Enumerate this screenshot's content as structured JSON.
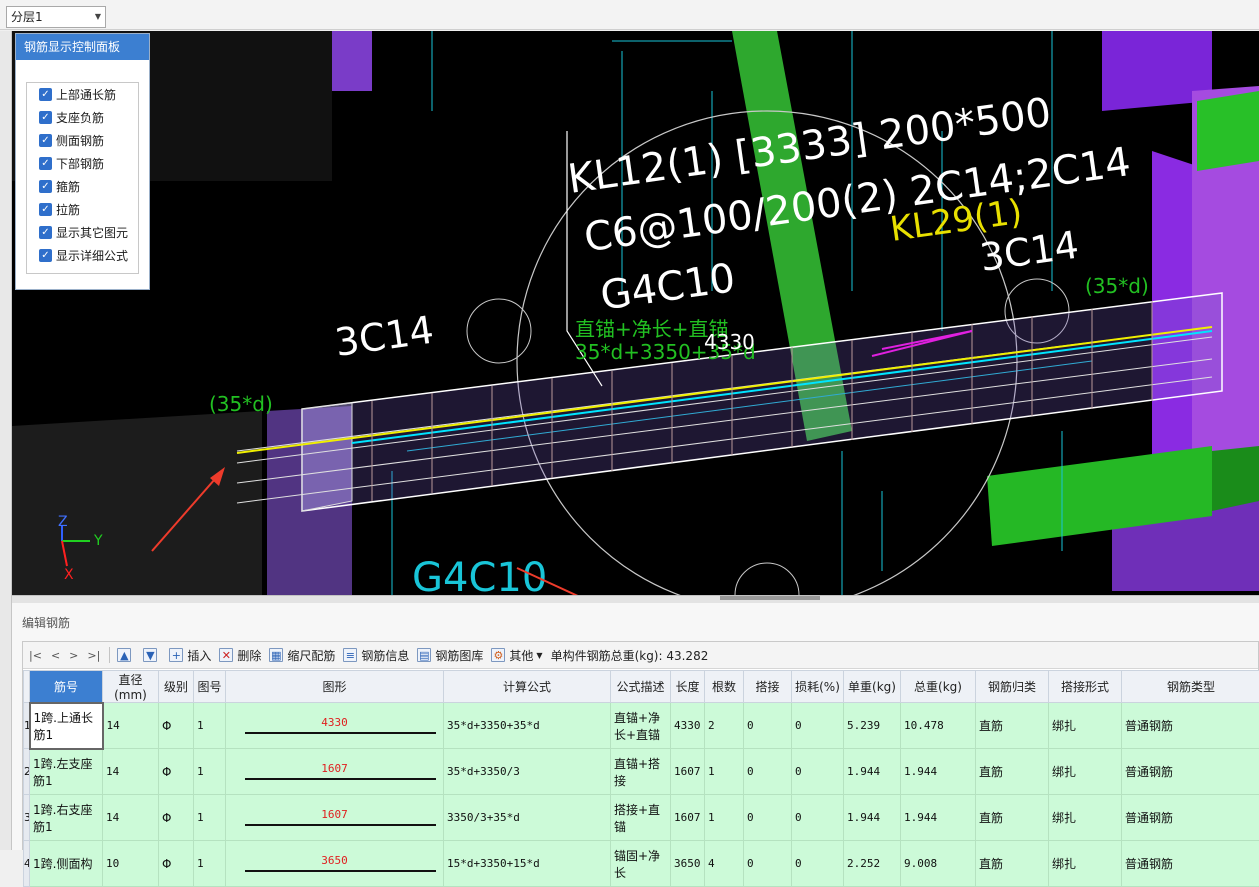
{
  "topbar": {
    "layer_value": "分层1"
  },
  "control_panel": {
    "title": "钢筋显示控制面板",
    "options": [
      {
        "label": "上部通长筋",
        "checked": true
      },
      {
        "label": "支座负筋",
        "checked": true
      },
      {
        "label": "侧面钢筋",
        "checked": true
      },
      {
        "label": "下部钢筋",
        "checked": true
      },
      {
        "label": "箍筋",
        "checked": true
      },
      {
        "label": "拉筋",
        "checked": true
      },
      {
        "label": "显示其它图元",
        "checked": true
      },
      {
        "label": "显示详细公式",
        "checked": true
      }
    ]
  },
  "viewport": {
    "beam_label_line1": "KL12(1) [3333] 200*500",
    "beam_label_line2": "C6@100/200(2) 2C14;2C14",
    "beam_label_line3": "G4C10",
    "kl29_label": "KL29(1)",
    "left_top_rebar": "3C14",
    "right_top_rebar": "3C14",
    "left_anchor": "(35*d)",
    "right_anchor": "(35*d)",
    "formula_desc": "直锚+净长+直锚",
    "formula_expr": "35*d+3350+35*d",
    "length_value": "4330",
    "under_label": "G4C10",
    "axis_z": "Z",
    "axis_y": "Y",
    "axis_x": "X"
  },
  "editor": {
    "title": "编辑钢筋",
    "toolbar": {
      "nav_first": "|<",
      "nav_prev": "<",
      "nav_next": ">",
      "nav_last": ">|",
      "insert": "插入",
      "delete": "删除",
      "scale": "缩尺配筋",
      "info": "钢筋信息",
      "library": "钢筋图库",
      "other": "其他",
      "total_weight": "单构件钢筋总重(kg): 43.282"
    },
    "columns": [
      "筋号",
      "直径(mm)",
      "级别",
      "图号",
      "图形",
      "计算公式",
      "公式描述",
      "长度",
      "根数",
      "搭接",
      "损耗(%)",
      "单重(kg)",
      "总重(kg)",
      "钢筋归类",
      "搭接形式",
      "钢筋类型"
    ],
    "rows": [
      {
        "idx": "1",
        "name": "1跨.上通长筋1",
        "dia": "14",
        "grade": "Φ",
        "fig": "1",
        "shape_len": "4330",
        "formula": "35*d+3350+35*d",
        "desc": "直锚+净长+直锚",
        "length": "4330",
        "count": "2",
        "lap": "0",
        "loss": "0",
        "unit_w": "5.239",
        "total_w": "10.478",
        "category": "直筋",
        "lap_type": "绑扎",
        "bar_type": "普通钢筋"
      },
      {
        "idx": "2",
        "name": "1跨.左支座筋1",
        "dia": "14",
        "grade": "Φ",
        "fig": "1",
        "shape_len": "1607",
        "formula": "35*d+3350/3",
        "desc": "直锚+搭接",
        "length": "1607",
        "count": "1",
        "lap": "0",
        "loss": "0",
        "unit_w": "1.944",
        "total_w": "1.944",
        "category": "直筋",
        "lap_type": "绑扎",
        "bar_type": "普通钢筋"
      },
      {
        "idx": "3",
        "name": "1跨.右支座筋1",
        "dia": "14",
        "grade": "Φ",
        "fig": "1",
        "shape_len": "1607",
        "formula": "3350/3+35*d",
        "desc": "搭接+直锚",
        "length": "1607",
        "count": "1",
        "lap": "0",
        "loss": "0",
        "unit_w": "1.944",
        "total_w": "1.944",
        "category": "直筋",
        "lap_type": "绑扎",
        "bar_type": "普通钢筋"
      },
      {
        "idx": "4",
        "name": "1跨.侧面构",
        "dia": "10",
        "grade": "Φ",
        "fig": "1",
        "shape_len": "3650",
        "formula": "15*d+3350+15*d",
        "desc": "锚固+净长",
        "length": "3650",
        "count": "4",
        "lap": "0",
        "loss": "0",
        "unit_w": "2.252",
        "total_w": "9.008",
        "category": "直筋",
        "lap_type": "绑扎",
        "bar_type": "普通钢筋"
      }
    ]
  }
}
